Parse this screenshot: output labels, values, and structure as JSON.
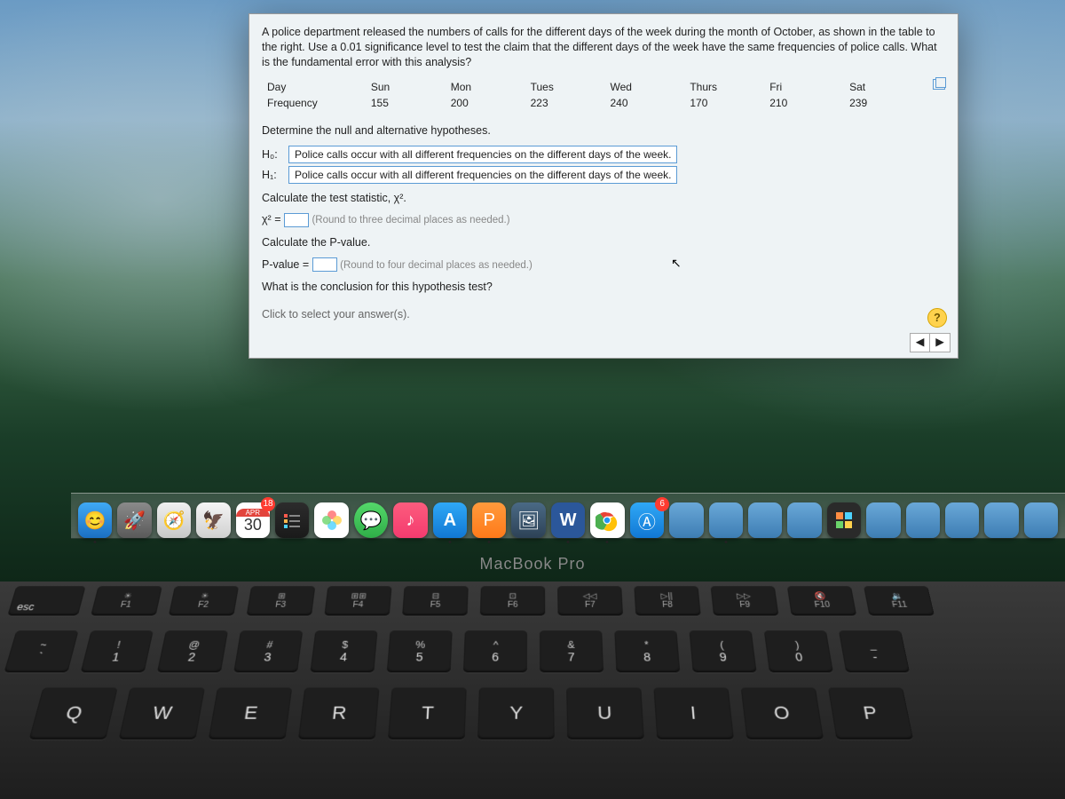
{
  "gear_icon": "⚙",
  "question": {
    "prompt": "A police department released the numbers of calls for the different days of the week during the month of October, as shown in the table to the right. Use a 0.01 significance level to test the claim that the different days of the week have the same frequencies of police calls. What is the fundamental error with this analysis?",
    "table": {
      "row_labels": [
        "Day",
        "Frequency"
      ],
      "columns": [
        "Sun",
        "Mon",
        "Tues",
        "Wed",
        "Thurs",
        "Fri",
        "Sat"
      ],
      "values": [
        155,
        200,
        223,
        240,
        170,
        210,
        239
      ]
    },
    "step1": "Determine the null and alternative hypotheses.",
    "h0_label": "H₀:",
    "h1_label": "H₁:",
    "h0_selected": "Police calls occur with all different frequencies on the different days of the week.",
    "h1_selected": "Police calls occur with all different frequencies on the different days of the week.",
    "step2": "Calculate the test statistic, χ².",
    "chi_label": "χ² =",
    "chi_hint": "(Round to three decimal places as needed.)",
    "step3": "Calculate the P-value.",
    "pval_label": "P-value =",
    "pval_hint": "(Round to four decimal places as needed.)",
    "step4": "What is the conclusion for this hypothesis test?",
    "click_prompt": "Click to select your answer(s)."
  },
  "help_label": "?",
  "nav_prev": "◀",
  "nav_next": "▶",
  "dock": {
    "calendar_month": "APR",
    "calendar_badge": "18",
    "calendar_day": "30",
    "word": "W",
    "appstore": "A",
    "appstore_badge": "6",
    "pages": "P"
  },
  "laptop": "MacBook Pro",
  "keys": {
    "esc": "esc",
    "fn": [
      "F1",
      "F2",
      "F3",
      "F4",
      "F5",
      "F6",
      "F7",
      "F8",
      "F9",
      "F10",
      "F11"
    ],
    "fn_icons": [
      "☀",
      "☀",
      "⊞",
      "⊞⊞",
      "⊟",
      "⊡",
      "◁◁",
      "▷||",
      "▷▷",
      "🔇",
      "🔉"
    ],
    "num_top": [
      "!",
      "@",
      "#",
      "$",
      "%",
      "^",
      "&",
      "*",
      "(",
      ")",
      "_"
    ],
    "num": [
      "1",
      "2",
      "3",
      "4",
      "5",
      "6",
      "7",
      "8",
      "9",
      "0",
      "-"
    ],
    "tilde": "~",
    "backtick": "`",
    "letters": [
      "Q",
      "W",
      "E",
      "R",
      "T",
      "Y",
      "U",
      "I",
      "O",
      "P"
    ]
  }
}
